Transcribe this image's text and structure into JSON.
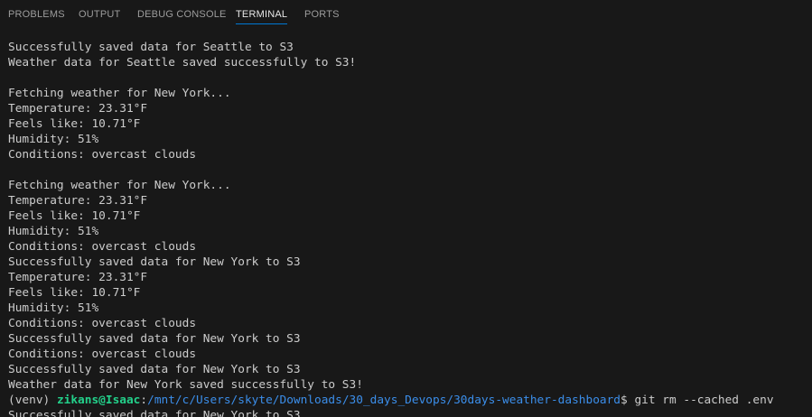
{
  "panel": {
    "tabs": [
      {
        "label": "PROBLEMS",
        "active": false
      },
      {
        "label": "OUTPUT",
        "active": false
      },
      {
        "label": "DEBUG CONSOLE",
        "active": false
      },
      {
        "label": "TERMINAL",
        "active": true
      },
      {
        "label": "PORTS",
        "active": false
      }
    ]
  },
  "terminal": {
    "lines": [
      "Successfully saved data for Seattle to S3",
      "Weather data for Seattle saved successfully to S3!",
      "",
      "Fetching weather for New York...",
      "Temperature: 23.31°F",
      "Feels like: 10.71°F",
      "Humidity: 51%",
      "Conditions: overcast clouds",
      "",
      "Fetching weather for New York...",
      "Temperature: 23.31°F",
      "Feels like: 10.71°F",
      "Humidity: 51%",
      "Conditions: overcast clouds",
      "Successfully saved data for New York to S3",
      "Temperature: 23.31°F",
      "Feels like: 10.71°F",
      "Humidity: 51%",
      "Conditions: overcast clouds",
      "Successfully saved data for New York to S3",
      "Conditions: overcast clouds",
      "Successfully saved data for New York to S3",
      "Weather data for New York saved successfully to S3!"
    ],
    "prompt": {
      "venv": "(venv) ",
      "user": "zikans@Isaac",
      "separator": ":",
      "path": "/mnt/c/Users/skyte/Downloads/30_days_Devops/30days-weather-dashboard",
      "symbol": "$ ",
      "command": "git rm --cached .env"
    },
    "trailing_line": "Successfully saved data for New York to S3",
    "colors": {
      "background": "#181818",
      "text": "#cccccc",
      "user": "#23d18b",
      "path": "#3b8eea",
      "active_tab_underline": "#0078d4"
    }
  }
}
